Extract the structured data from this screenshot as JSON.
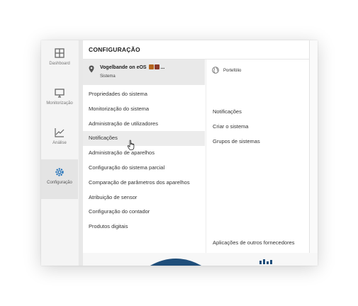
{
  "sidebar": {
    "items": [
      {
        "label": "Dashboard",
        "icon": "dashboard-icon"
      },
      {
        "label": "Monitorização",
        "icon": "monitor-icon"
      },
      {
        "label": "Análise",
        "icon": "chart-icon"
      },
      {
        "label": "Configuração",
        "icon": "gear-icon",
        "active": true
      }
    ]
  },
  "panel": {
    "title": "CONFIGURAÇÃO",
    "system": {
      "name": "Vogelbande on eOS",
      "suffix": "...",
      "subtitle": "Sistema"
    },
    "menu": [
      "Propriedades do sistema",
      "Monitorização do sistema",
      "Administração de utilizadores",
      "Notificações",
      "Administração de aparelhos",
      "Configuração do sistema parcial",
      "Comparação de parâmetros dos aparelhos",
      "Atribuição de sensor",
      "Configuração do contador",
      "Produtos digitais"
    ],
    "hovered_index": 3,
    "right": {
      "portfolio_label": "Portefólio",
      "items": [
        "Notificações",
        "Criar o sistema",
        "Grupos de sistemas"
      ],
      "bottom_item": "Aplicações de outros fornecedores"
    }
  },
  "colors": {
    "accent": "#1e6fb8",
    "donut": "#1f4e7a"
  }
}
